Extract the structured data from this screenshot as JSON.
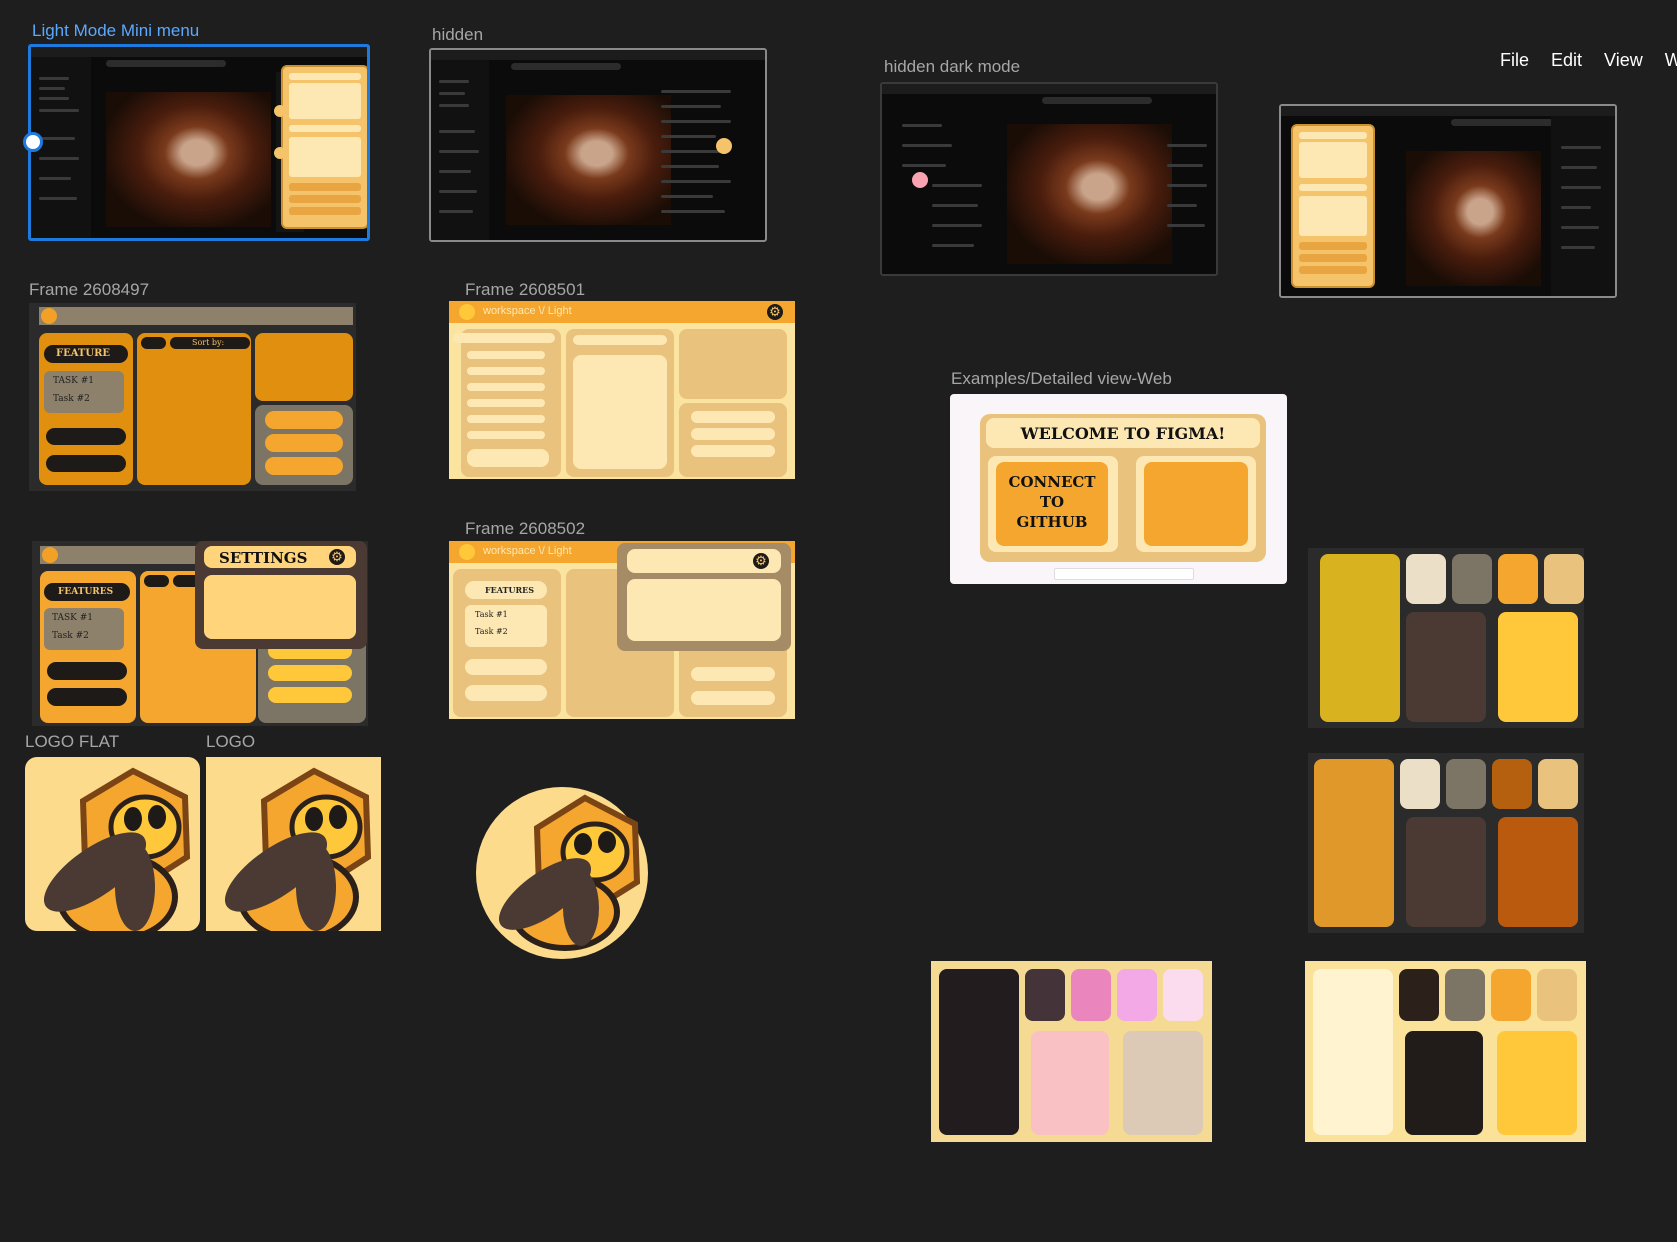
{
  "menu": {
    "file": "File",
    "edit": "Edit",
    "view": "View",
    "more": "W"
  },
  "labels": {
    "light_mini": "Light Mode Mini menu",
    "hidden": "hidden",
    "hidden_dark": "hidden dark mode",
    "frame_497": "Frame 2608497",
    "frame_501": "Frame 2608501",
    "frame_502": "Frame 2608502",
    "examples": "Examples/Detailed view-Web",
    "logo_flat": "LOGO FLAT",
    "logo": "LOGO"
  },
  "frame497": {
    "feature": "FEATURE",
    "task1": "TASK #1",
    "task2": "Task #2",
    "sort": "Sort by:"
  },
  "frame501": {
    "header": "workspace \\/ Light"
  },
  "frame502": {
    "header": "workspace \\/ Light",
    "features": "FEATURES",
    "task1": "Task #1",
    "task2": "Task #2"
  },
  "settings_frame": {
    "title": "SETTINGS",
    "features": "FEATURES",
    "task1": "TASK #1",
    "task2": "Task #2"
  },
  "figma_card": {
    "welcome": "WELCOME TO FIGMA!",
    "connect": "CONNECT TO GITHUB"
  },
  "palettes": [
    {
      "colors": [
        "#d8b21f",
        "#ebdfc7",
        "#7c7565",
        "#f4a62f",
        "#e9c27d",
        "#4a3a33",
        "#ffc83a"
      ]
    },
    {
      "colors": [
        "#e0982b",
        "#ebdfc7",
        "#7c7565",
        "#b5600f",
        "#e9c27d",
        "#4a3a33",
        "#b95a0f"
      ]
    },
    {
      "colors": [
        "#231c1f",
        "#45333a",
        "#ea86bd",
        "#f2a9e6",
        "#fadcee",
        "#f9c1c4",
        "#dccab7",
        "#f4da93"
      ]
    },
    {
      "colors": [
        "#fff3d0",
        "#2b211a",
        "#7c7565",
        "#f4a62f",
        "#e9c27d",
        "#211c1a",
        "#ffc83a",
        "#fbe29a"
      ]
    }
  ]
}
